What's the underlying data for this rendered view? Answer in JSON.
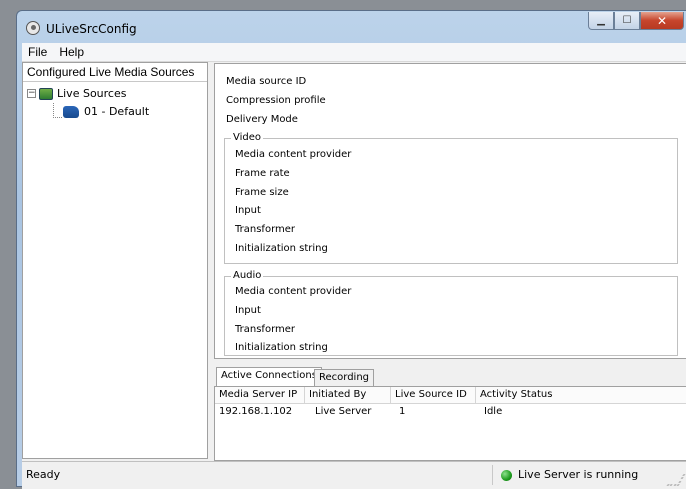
{
  "window": {
    "title": "ULiveSrcConfig"
  },
  "menu": [
    "File",
    "Help"
  ],
  "left_panel": {
    "header": "Configured Live Media Sources",
    "tree": {
      "root_label": "Live Sources",
      "root_expander": "−",
      "child_label": "01 - Default"
    }
  },
  "details": {
    "media_source_id": "Media source ID",
    "compression_profile": "Compression profile",
    "delivery_mode": "Delivery Mode",
    "video": {
      "title": "Video",
      "fields": [
        "Media content provider",
        "Frame rate",
        "Frame size",
        "Input",
        "Transformer",
        "Initialization string"
      ]
    },
    "audio": {
      "title": "Audio",
      "fields": [
        "Media content provider",
        "Input",
        "Transformer",
        "Initialization string"
      ]
    }
  },
  "tabs": [
    {
      "label": "Active Connections",
      "active": true
    },
    {
      "label": "Recording",
      "active": false
    }
  ],
  "connections": {
    "columns": [
      "Media Server IP",
      "Initiated By",
      "Live Source ID",
      "Activity Status"
    ],
    "rows": [
      [
        "192.168.1.102",
        "Live Server",
        "1",
        "Idle"
      ]
    ]
  },
  "status": {
    "left": "Ready",
    "right": "Live Server is running",
    "indicator_color": "#1e9b1e"
  },
  "colors": {
    "title_bar": "#a9c4e2",
    "close_button": "#c7452c"
  }
}
